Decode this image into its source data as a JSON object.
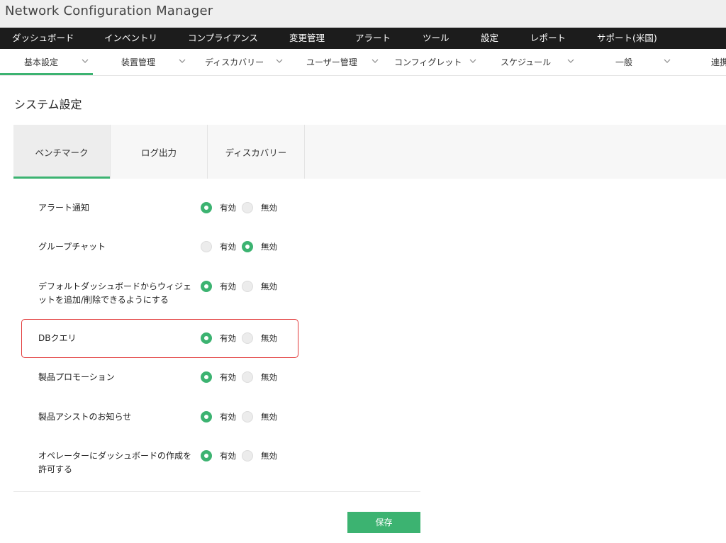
{
  "app": {
    "title": "Network Configuration Manager"
  },
  "main_nav": [
    "ダッシュボード",
    "インベントリ",
    "コンプライアンス",
    "変更管理",
    "アラート",
    "ツール",
    "設定",
    "レポート",
    "サポート(米国)"
  ],
  "sub_nav": [
    {
      "label": "基本設定",
      "active": true
    },
    {
      "label": "装置管理"
    },
    {
      "label": "ディスカバリー"
    },
    {
      "label": "ユーザー管理"
    },
    {
      "label": "コンフィグレット"
    },
    {
      "label": "スケジュール"
    },
    {
      "label": "一般"
    },
    {
      "label": "連携"
    }
  ],
  "page": {
    "title": "システム設定"
  },
  "tabs": [
    {
      "label": "ベンチマーク",
      "active": true
    },
    {
      "label": "ログ出力"
    },
    {
      "label": "ディスカバリー"
    }
  ],
  "radio_labels": {
    "enabled": "有効",
    "disabled": "無効"
  },
  "settings": [
    {
      "label": "アラート通知",
      "value": "有効"
    },
    {
      "label": "グループチャット",
      "value": "無効"
    },
    {
      "label": "デフォルトダッシュボードからウィジェットを追加/削除できるようにする",
      "value": "有効"
    },
    {
      "label": "DBクエリ",
      "value": "有効",
      "highlighted": true
    },
    {
      "label": "製品プロモーション",
      "value": "有効"
    },
    {
      "label": "製品アシストのお知らせ",
      "value": "有効"
    },
    {
      "label": "オペレーターにダッシュボードの作成を許可する",
      "value": "有効"
    }
  ],
  "save_label": "保存",
  "colors": {
    "accent": "#3cb371",
    "nav_bg": "#1c1c1c",
    "highlight": "#e23a3a"
  }
}
